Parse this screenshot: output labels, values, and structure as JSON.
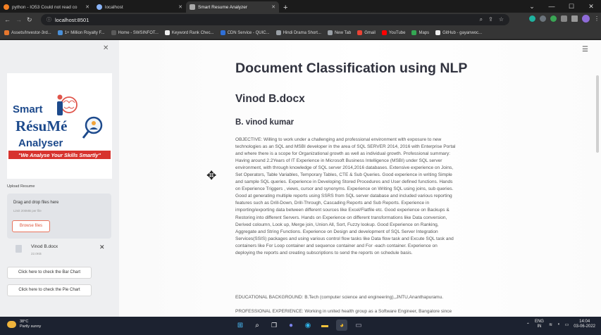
{
  "browser": {
    "tabs": [
      {
        "title": "python - IO53 Could not read co",
        "icon_color": "#f48024",
        "active": false
      },
      {
        "title": "localhost",
        "icon_color": "#8ab4f8",
        "active": false
      },
      {
        "title": "Smart Resume Analyzer",
        "icon_color": "#aaaaaa",
        "active": true
      }
    ],
    "new_tab_label": "+",
    "url": "localhost:8501",
    "bookmarks": [
      {
        "label": "Assets/Investor-3rd...",
        "color": "#e6772e"
      },
      {
        "label": "1+ Million Royalty F...",
        "color": "#4a90d9"
      },
      {
        "label": "Home - SWSINFOT...",
        "color": "#5a5a5a"
      },
      {
        "label": "Keyword Rank Chec...",
        "color": "#eeeeee"
      },
      {
        "label": "CDN Service - QUIC...",
        "color": "#2f6fd6"
      },
      {
        "label": "Hindi Drama Short...",
        "color": "#9aa0a6"
      },
      {
        "label": "New Tab",
        "color": "#9aa0a6"
      },
      {
        "label": "Gmail",
        "color": "#ea4335"
      },
      {
        "label": "YouTube",
        "color": "#ff0000"
      },
      {
        "label": "Maps",
        "color": "#34a853"
      },
      {
        "label": "GitHub - gayanwoc...",
        "color": "#eeeeee"
      }
    ]
  },
  "sidebar": {
    "logo": {
      "line1": "Smart",
      "line2": "RésuMé",
      "line3": "Analyser",
      "tagline": "\"We Analyse Your Skills Smartly\""
    },
    "upload_label": "Upload Resume",
    "dropzone_title": "Drag and drop files here",
    "dropzone_limit": "Limit 200MB per file",
    "browse_label": "Browse files",
    "file": {
      "name": "Vinod B.docx",
      "size": "22.0KB"
    },
    "bar_chart_button": "Click here to check the Bar Chart",
    "pie_chart_button": "Click here to check the Pie Chart"
  },
  "main": {
    "title": "Document Classification using NLP",
    "file_heading": "Vinod B.docx",
    "candidate_name": "B. vinod kumar",
    "resume_lines": [
      "OBJECTIVE: Willing to work under a challenging and professional environment with exposure to new",
      "technologies as an SQL and MSBI developer in the area of SQL SERVER 2014, 2016 with Enterprise Portal",
      "and where there is a scope for Organizational growth as well as individual growth. Professional summary:",
      "Having around 2.2Years of IT Experience in Microsoft Business Intelligence (MSBI) under SQL server",
      "environment, with through knowledge of SQL server 2014,2016 databases. Extensive experience on Joins,",
      "Set Operators, Table Variables, Temporary Tables, CTE & Sub Queries. Good experience in writing Simple",
      "and sample SQL queries. Experience in Developing Stored Procedures and User defined functions. Hands",
      "on Experience Triggers , views, cursor and synonyms. Experience on Writing SQL using joins, sub queries.",
      "Good at generating multiple reports using SSRS from SQL server database and included various reporting",
      "features such as Drill-Down, Drill-Through, Cascading Reports and Sub Reports. Experience in",
      "importing/exporting data between different sources like Excel/Flatfile etc. Good experience on Backups &",
      "Restoring into different Servers. Hands on Experience on different transformations like Data conversion,",
      "Derived coloumn, Look up, Merge join, Union All, Sort, Fuzzy lookup. Good Experience on Ranking,",
      "Aggregate and String Functions. Experience on Design and development of SQL Server Integration",
      "Services(SSIS) packages and using various control flow tasks like Data flow task and Excute SQL task and",
      "containers like For Loop container and sequence container and For -each container. Experience on",
      "deploying the reports and creating subscriptions to send the reports on schedule basis."
    ],
    "education": "EDUCATIONAL BACKGROUND: B.Tech (computer science and engineering),,JNTU,Ananthapuramu.",
    "experience": "PROFESSIONAL EXPERIENCE: Working in united health group as a Software Engineer, Bangalore since"
  },
  "taskbar": {
    "temperature": "38°C",
    "condition": "Partly sunny",
    "lang_top": "ENG",
    "lang_bottom": "IN",
    "time": "14:04",
    "date": "03-06-2022"
  }
}
